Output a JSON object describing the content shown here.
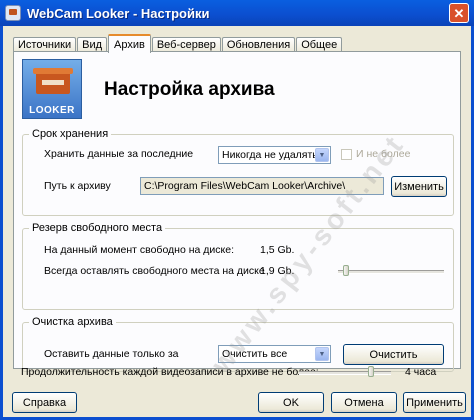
{
  "window": {
    "title": "WebCam Looker - Настройки",
    "close_label": "✕"
  },
  "tabs": [
    "Источники",
    "Вид",
    "Архив",
    "Веб-сервер",
    "Обновления",
    "Общее"
  ],
  "header": {
    "logo_text": "LOOKER",
    "title": "Настройка архива"
  },
  "storage": {
    "legend": "Срок хранения",
    "keep_label": "Хранить данные за последние",
    "keep_value": "Никогда не удалять",
    "no_more_label": "И не более",
    "path_label": "Путь к архиву",
    "path_value": "C:\\Program Files\\WebCam Looker\\Archive\\",
    "change_button": "Изменить"
  },
  "reserve": {
    "legend": "Резерв свободного места",
    "free_label": "На данный момент свободно на диске:",
    "free_value": "1,5 Gb.",
    "leave_label": "Всегда оставлять свободного места на диске",
    "leave_value": "1,9 Gb.",
    "leave_slider_fraction": 0.05
  },
  "cleanup": {
    "legend": "Очистка архива",
    "keep_only_label": "Оставить данные только за",
    "keep_only_value": "Очистить все",
    "clean_button": "Очистить"
  },
  "duration": {
    "label": "Продолжительность каждой видеозаписи в архиве не более:",
    "value": "4 часа",
    "slider_fraction": 0.8
  },
  "footer": {
    "help": "Справка",
    "ok": "OK",
    "cancel": "Отмена",
    "apply": "Применить"
  },
  "watermark": "www.spy-soft.net"
}
